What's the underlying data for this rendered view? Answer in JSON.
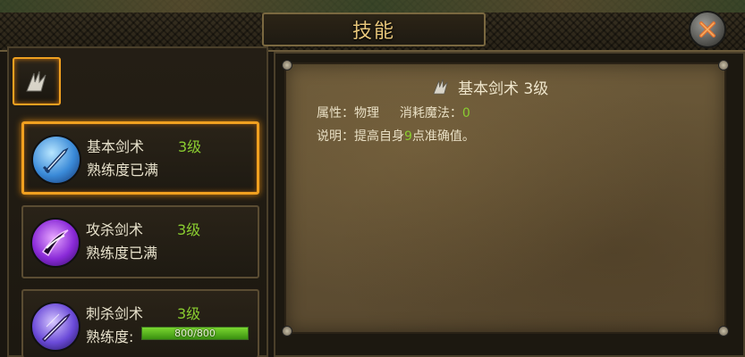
{
  "header": {
    "title": "技能"
  },
  "skills": [
    {
      "name": "基本剑术",
      "level": "3级",
      "status": "熟练度已满",
      "icon": "sword-icon"
    },
    {
      "name": "攻杀剑术",
      "level": "3级",
      "status": "熟练度已满",
      "icon": "slash-icon"
    },
    {
      "name": "刺杀剑术",
      "level": "3级",
      "status_label": "熟练度:",
      "progress_text": "800/800",
      "progress": 1.0,
      "icon": "thrust-icon"
    }
  ],
  "detail": {
    "title": "基本剑术  3级",
    "attr_label": "属性：物理",
    "mana_label": "消耗魔法：",
    "mana_value": "0",
    "desc_label": "说明：提高自身",
    "desc_value": "9",
    "desc_suffix": "点准确值。"
  },
  "colors": {
    "accent": "#f0a020",
    "green": "#8acd30",
    "title": "#e7c67a"
  }
}
